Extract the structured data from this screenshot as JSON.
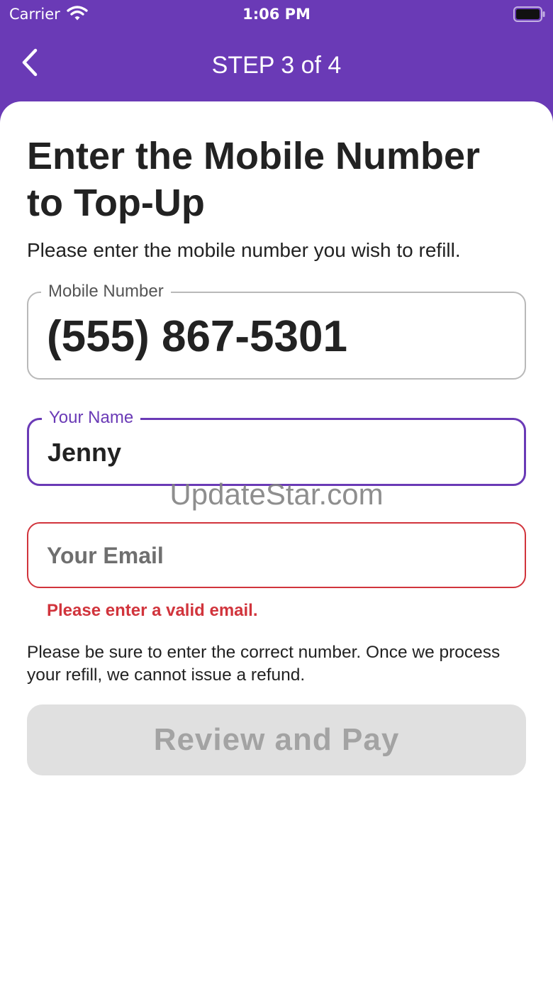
{
  "status_bar": {
    "carrier": "Carrier",
    "time": "1:06 PM",
    "wifi_icon": "wifi-icon",
    "battery_icon": "battery-icon"
  },
  "nav": {
    "back_icon": "chevron-left-icon",
    "title": "STEP 3 of 4"
  },
  "form": {
    "heading": "Enter the Mobile Number to Top-Up",
    "subtitle": "Please enter the mobile number you wish to refill.",
    "mobile": {
      "label": "Mobile Number",
      "value": "(555) 867-5301"
    },
    "name": {
      "label": "Your Name",
      "value": "Jenny"
    },
    "email": {
      "placeholder": "Your Email",
      "value": "",
      "error": "Please enter a valid email."
    },
    "disclaimer": "Please be sure to enter the correct number. Once we process your refill, we cannot issue a refund.",
    "submit_label": "Review and Pay"
  },
  "watermark": "UpdateStar.com",
  "colors": {
    "brand_purple": "#6a3ab6",
    "error_red": "#d1343c",
    "disabled_button_bg": "#e0e0e0",
    "disabled_button_text": "#a3a3a3"
  }
}
